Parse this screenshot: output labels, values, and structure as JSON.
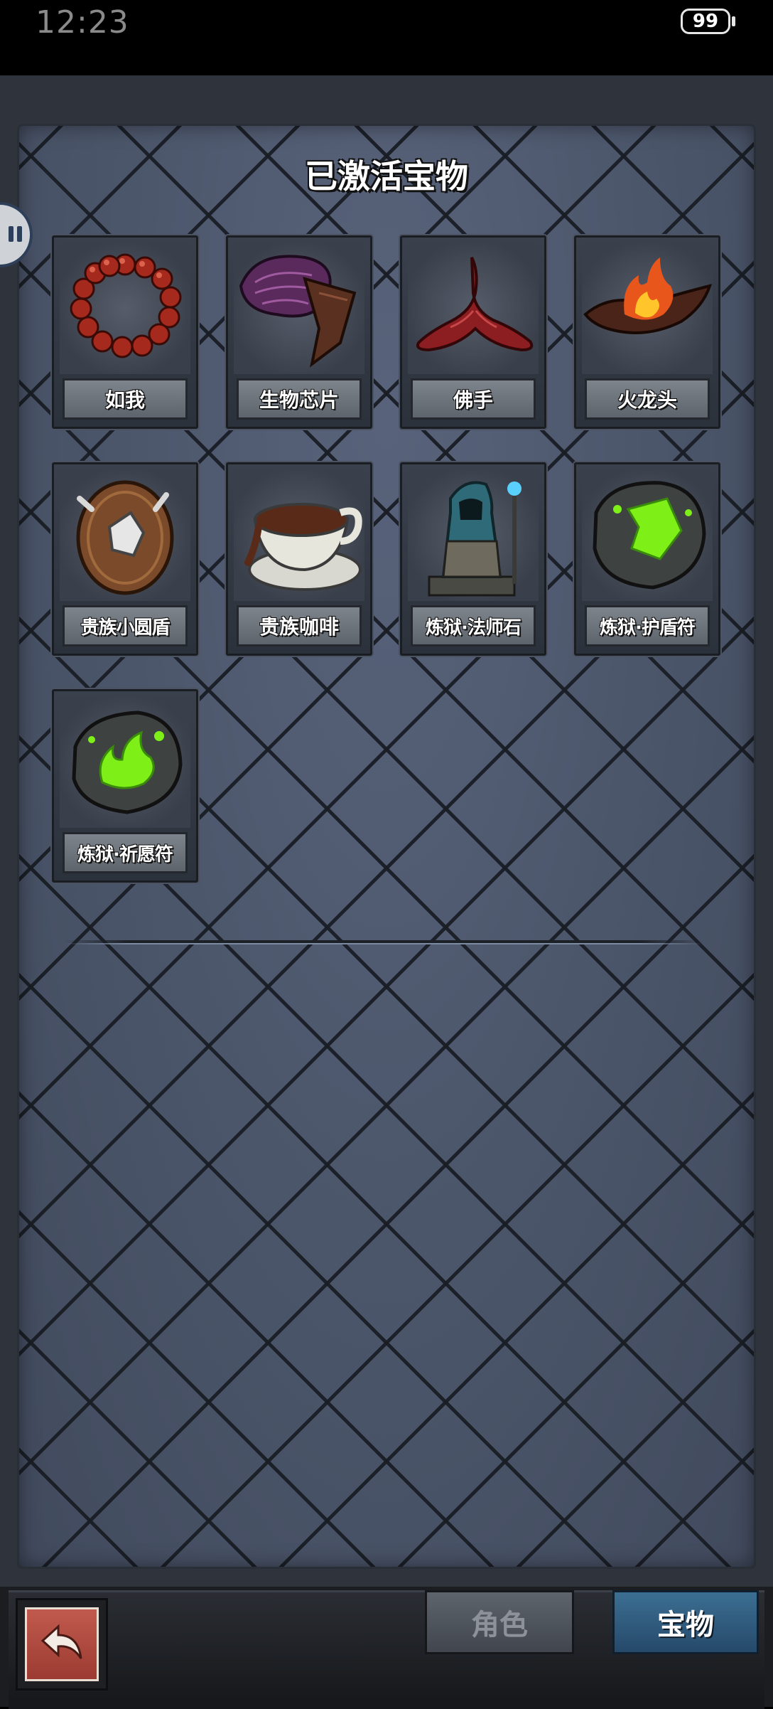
{
  "status_bar": {
    "time": "12:23",
    "battery": "99"
  },
  "panel": {
    "title": "已激活宝物"
  },
  "items": [
    {
      "label": "如我",
      "icon": "prayer-beads-icon"
    },
    {
      "label": "生物芯片",
      "icon": "biochip-icon"
    },
    {
      "label": "佛手",
      "icon": "buddha-hand-icon"
    },
    {
      "label": "火龙头",
      "icon": "fire-dragon-head-icon"
    },
    {
      "label": "贵族小圆盾",
      "icon": "round-shield-icon"
    },
    {
      "label": "贵族咖啡",
      "icon": "coffee-cup-icon"
    },
    {
      "label": "炼狱·法师石",
      "icon": "mage-statue-icon"
    },
    {
      "label": "炼狱·护盾符",
      "icon": "green-rune-stone-icon"
    },
    {
      "label": "炼狱·祈愿符",
      "icon": "green-flame-stone-icon"
    }
  ],
  "bottom_bar": {
    "role_tab": "角色",
    "treasure_tab": "宝物"
  }
}
